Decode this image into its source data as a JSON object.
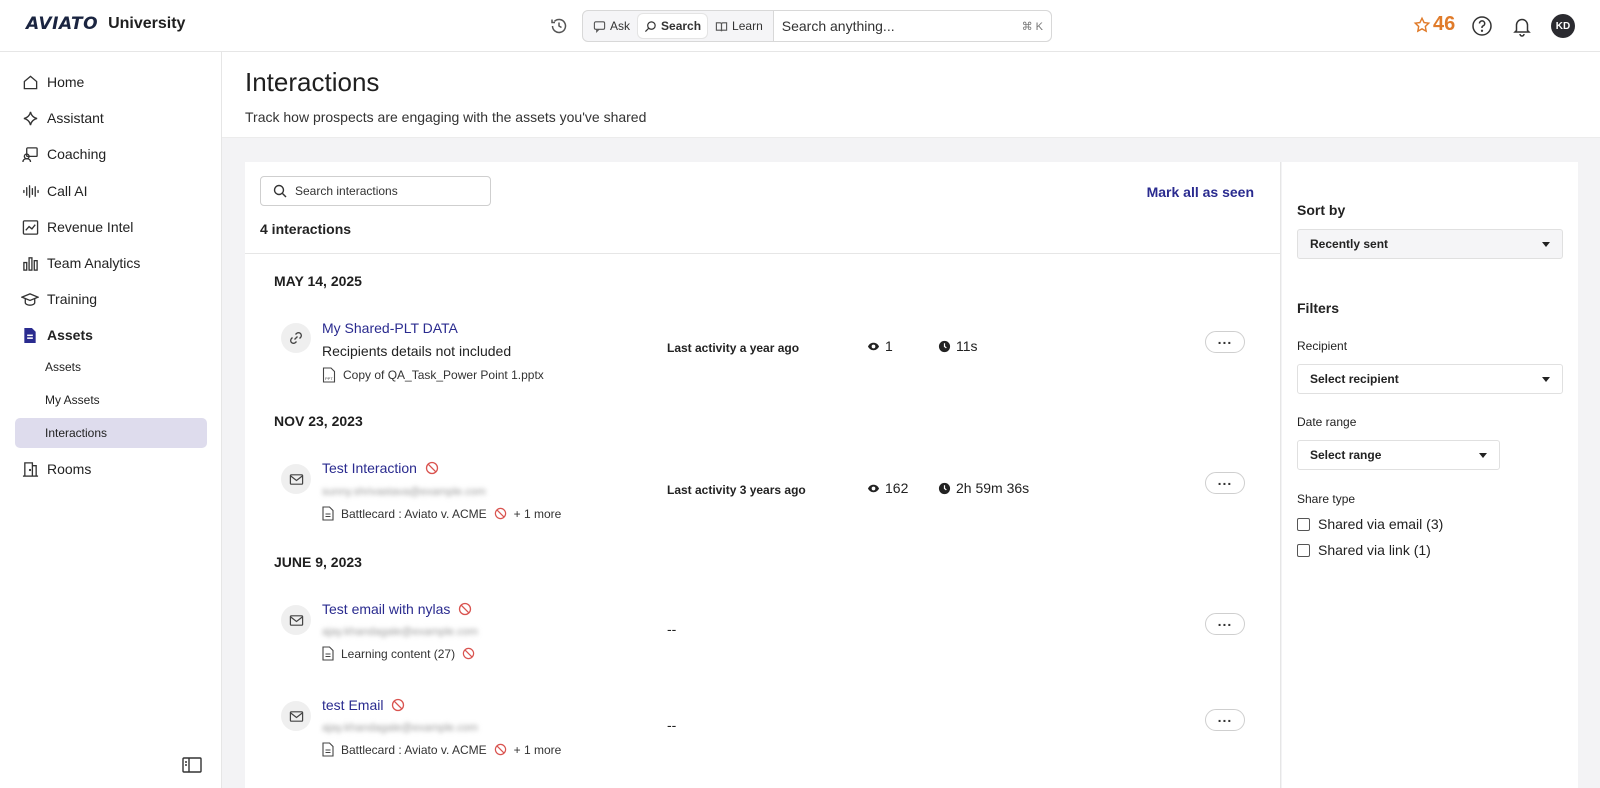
{
  "brand": {
    "logo": "AVIATO",
    "name": "University"
  },
  "search": {
    "modes": [
      "Ask",
      "Search",
      "Learn"
    ],
    "active_mode": "Search",
    "placeholder": "Search anything...",
    "shortcut": "⌘ K"
  },
  "header_right": {
    "points": "46",
    "avatar_initials": "KD"
  },
  "sidebar": {
    "items": [
      {
        "label": "Home",
        "icon": "home-icon"
      },
      {
        "label": "Assistant",
        "icon": "sparkle-icon"
      },
      {
        "label": "Coaching",
        "icon": "coaching-icon"
      },
      {
        "label": "Call AI",
        "icon": "waveform-icon"
      },
      {
        "label": "Revenue Intel",
        "icon": "revenue-chart-icon"
      },
      {
        "label": "Team Analytics",
        "icon": "bar-chart-icon"
      },
      {
        "label": "Training",
        "icon": "graduation-cap-icon"
      },
      {
        "label": "Assets",
        "icon": "file-icon"
      }
    ],
    "sub_items": [
      "Assets",
      "My Assets",
      "Interactions"
    ],
    "active_sub": "Interactions",
    "rooms": {
      "label": "Rooms",
      "icon": "rooms-icon"
    }
  },
  "page": {
    "title": "Interactions",
    "subtitle": "Track how prospects are engaging with the assets you've shared"
  },
  "list": {
    "search_placeholder": "Search interactions",
    "mark_all": "Mark all as seen",
    "count": "4 interactions",
    "groups": [
      {
        "date": "MAY 14, 2025"
      },
      {
        "date": "NOV 23, 2023"
      },
      {
        "date": "JUNE 9, 2023"
      }
    ],
    "rows": [
      {
        "type": "link",
        "title": "My Shared-PLT DATA",
        "subtitle": "Recipients details not included",
        "asset": "Copy of QA_Task_Power Point 1.pptx",
        "activity": "Last activity a year ago",
        "views": "1",
        "time": "11s"
      },
      {
        "type": "email",
        "title": "Test Interaction",
        "recipient": "sunny.shrivastava@example.com",
        "asset": "Battlecard : Aviato v. ACME",
        "more": "+ 1 more",
        "activity": "Last activity 3 years ago",
        "views": "162",
        "time": "2h 59m 36s"
      },
      {
        "type": "email",
        "title": "Test email with nylas",
        "recipient": "ajay.khandagale@example.com",
        "asset": "Learning content (27)",
        "activity": "--"
      },
      {
        "type": "email",
        "title": "test Email",
        "recipient": "ajay.khandagale@example.com",
        "asset": "Battlecard : Aviato v. ACME",
        "more": "+ 1 more",
        "activity": "--"
      }
    ]
  },
  "filters": {
    "sort_label": "Sort by",
    "sort_value": "Recently sent",
    "heading": "Filters",
    "recipient_label": "Recipient",
    "recipient_value": "Select recipient",
    "date_label": "Date range",
    "date_value": "Select range",
    "share_label": "Share type",
    "share_options": [
      "Shared via email (3)",
      "Shared via link (1)"
    ]
  },
  "colors": {
    "accent": "#2a2b8f",
    "points": "#e07b2a",
    "active_nav": "#dedced"
  }
}
